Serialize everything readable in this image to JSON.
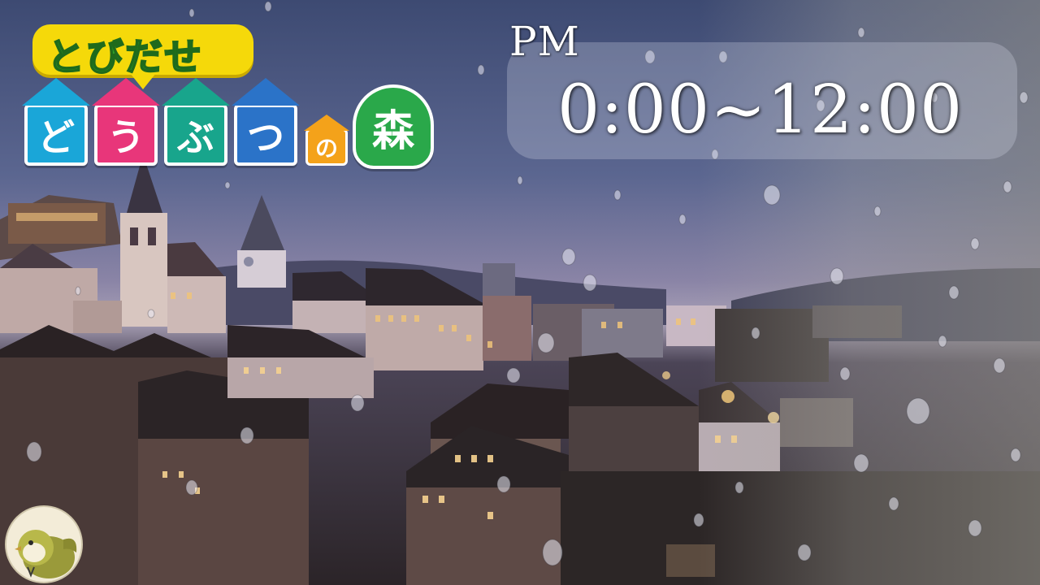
{
  "logo": {
    "line1": "とびだせ",
    "tiles": [
      {
        "char": "ど",
        "color": "#1aa6d8"
      },
      {
        "char": "う",
        "color": "#e8367a"
      },
      {
        "char": "ぶ",
        "color": "#18a58c"
      },
      {
        "char": "つ",
        "color": "#2b73c8"
      }
    ],
    "no_char": "の",
    "mori_char": "森"
  },
  "schedule": {
    "period": "PM",
    "range": "0:00~12:00"
  },
  "colors": {
    "logo_yellow": "#f5d90a",
    "logo_green_text": "#2f9f2a",
    "mori_green": "#2aa84a",
    "no_orange": "#f4a21a"
  },
  "icons": {
    "channel_avatar": "bird-avatar-icon"
  }
}
